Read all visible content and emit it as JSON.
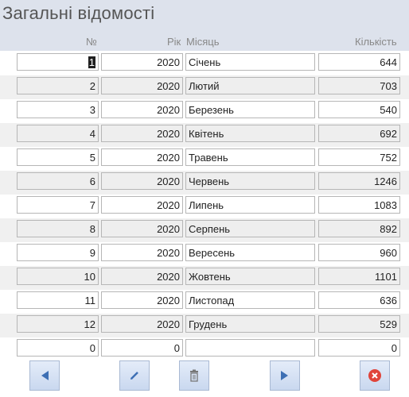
{
  "form": {
    "title": "Загальні відомості"
  },
  "columns": {
    "no": "№",
    "year": "Рік",
    "month": "Місяць",
    "qty": "Кількість"
  },
  "rows": [
    {
      "no": "1",
      "year": "2020",
      "month": "Січень",
      "qty": "644"
    },
    {
      "no": "2",
      "year": "2020",
      "month": "Лютий",
      "qty": "703"
    },
    {
      "no": "3",
      "year": "2020",
      "month": "Березень",
      "qty": "540"
    },
    {
      "no": "4",
      "year": "2020",
      "month": "Квітень",
      "qty": "692"
    },
    {
      "no": "5",
      "year": "2020",
      "month": "Травень",
      "qty": "752"
    },
    {
      "no": "6",
      "year": "2020",
      "month": "Червень",
      "qty": "1246"
    },
    {
      "no": "7",
      "year": "2020",
      "month": "Липень",
      "qty": "1083"
    },
    {
      "no": "8",
      "year": "2020",
      "month": "Серпень",
      "qty": "892"
    },
    {
      "no": "9",
      "year": "2020",
      "month": "Вересень",
      "qty": "960"
    },
    {
      "no": "10",
      "year": "2020",
      "month": "Жовтень",
      "qty": "1101"
    },
    {
      "no": "11",
      "year": "2020",
      "month": "Листопад",
      "qty": "636"
    },
    {
      "no": "12",
      "year": "2020",
      "month": "Грудень",
      "qty": "529"
    }
  ],
  "new_row": {
    "no": "0",
    "year": "0",
    "month": "",
    "qty": "0"
  },
  "toolbar": {
    "prev_icon": "triangle-left-icon",
    "edit_icon": "pencil-icon",
    "delete_icon": "trash-icon",
    "next_icon": "triangle-right-icon",
    "close_icon": "close-circle-icon"
  },
  "colors": {
    "header_bg": "#dde2ec",
    "alt_row_bg": "#f0f0f0",
    "button_bg": "#d6e2f4",
    "icon_blue": "#3d6fb4",
    "close_red": "#e0443a"
  }
}
